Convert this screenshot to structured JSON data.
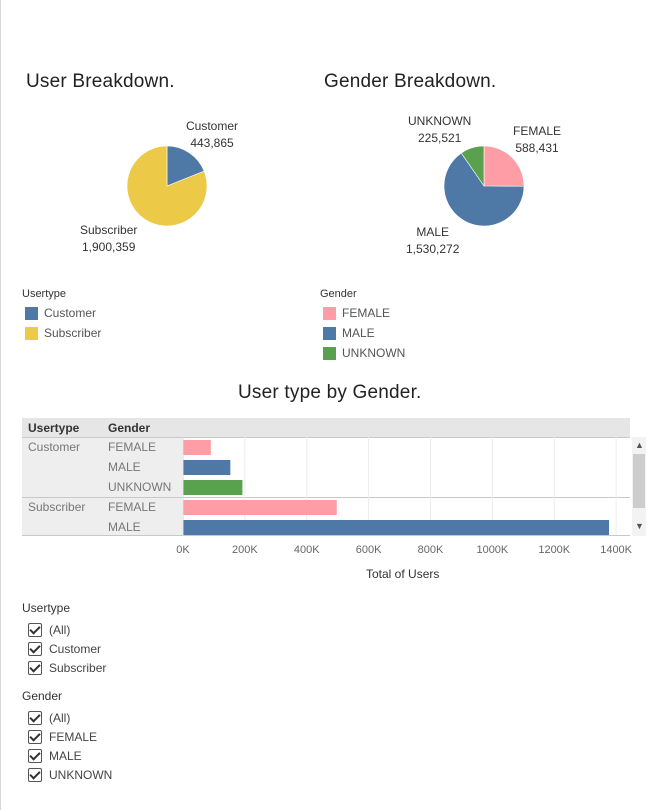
{
  "titles": {
    "user": "User Breakdown.",
    "gender": "Gender Breakdown.",
    "usertype_gender": "User type by Gender."
  },
  "colors": {
    "customer": "#4e79a7",
    "subscriber": "#edc948",
    "female": "#ff9da7",
    "male": "#4e79a7",
    "unknown": "#59a14f"
  },
  "chart_data": [
    {
      "type": "pie",
      "title": "User Breakdown.",
      "labels": [
        "Customer",
        "Subscriber"
      ],
      "values": [
        443865,
        1900359
      ],
      "value_labels": [
        "443,865",
        "1,900,359"
      ]
    },
    {
      "type": "pie",
      "title": "Gender Breakdown.",
      "labels": [
        "FEMALE",
        "MALE",
        "UNKNOWN"
      ],
      "values": [
        588431,
        1530272,
        225521
      ],
      "value_labels": [
        "588,431",
        "1,530,272",
        "225,521"
      ]
    },
    {
      "type": "bar",
      "title": "User type by Gender.",
      "orientation": "horizontal",
      "row_headers": [
        "Usertype",
        "Gender"
      ],
      "rows": [
        {
          "usertype": "Customer",
          "gender": "FEMALE",
          "value": 90000
        },
        {
          "usertype": "",
          "gender": "MALE",
          "value": 153000
        },
        {
          "usertype": "",
          "gender": "UNKNOWN",
          "value": 192000
        },
        {
          "usertype": "Subscriber",
          "gender": "FEMALE",
          "value": 497000
        },
        {
          "usertype": "",
          "gender": "MALE",
          "value": 1377000
        }
      ],
      "xlabel": "Total of Users",
      "xlim": [
        0,
        1400000
      ],
      "xticks": [
        "0K",
        "200K",
        "400K",
        "600K",
        "800K",
        "1000K",
        "1200K",
        "1400K"
      ],
      "grid": true
    }
  ],
  "legends": {
    "user": {
      "title": "Usertype",
      "items": [
        "Customer",
        "Subscriber"
      ]
    },
    "gender": {
      "title": "Gender",
      "items": [
        "FEMALE",
        "MALE",
        "UNKNOWN"
      ]
    }
  },
  "filters": {
    "usertype": {
      "title": "Usertype",
      "options": [
        "(All)",
        "Customer",
        "Subscriber"
      ]
    },
    "gender": {
      "title": "Gender",
      "options": [
        "(All)",
        "FEMALE",
        "MALE",
        "UNKNOWN"
      ]
    }
  }
}
